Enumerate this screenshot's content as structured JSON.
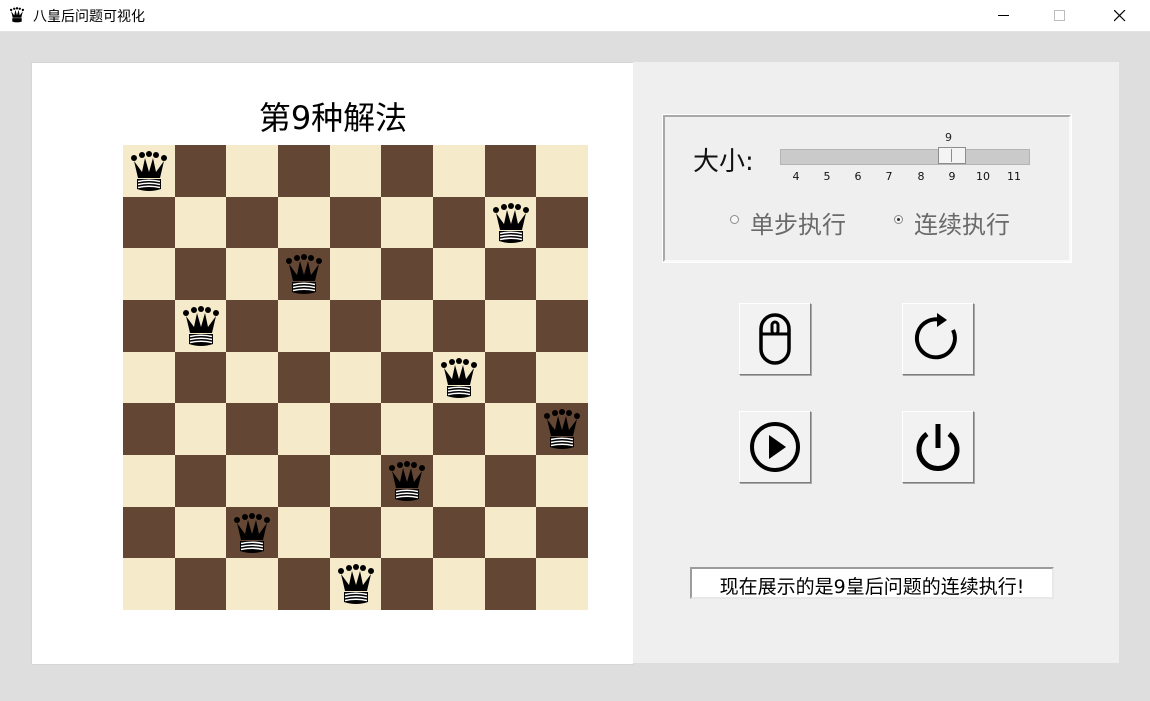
{
  "window": {
    "title": "八皇后问题可视化",
    "icon": "queen-icon",
    "controls": [
      "minimize-icon",
      "maximize-icon",
      "close-icon"
    ]
  },
  "board": {
    "title": "第9种解法",
    "size": 9,
    "queen_columns": [
      0,
      7,
      3,
      1,
      6,
      8,
      5,
      2,
      4
    ],
    "colors": {
      "light": "#f5ebcb",
      "dark": "#634633"
    }
  },
  "settings": {
    "size_label": "大小:",
    "slider": {
      "value": "9",
      "min": 4,
      "max": 11,
      "ticks": [
        "4",
        "5",
        "6",
        "7",
        "8",
        "9",
        "10",
        "11"
      ]
    },
    "modes": [
      {
        "label": "单步执行",
        "checked": false
      },
      {
        "label": "连续执行",
        "checked": true
      }
    ]
  },
  "buttons": [
    "mouse-icon",
    "reset-icon",
    "play-icon",
    "power-icon"
  ],
  "status": "现在展示的是9皇后问题的连续执行!"
}
